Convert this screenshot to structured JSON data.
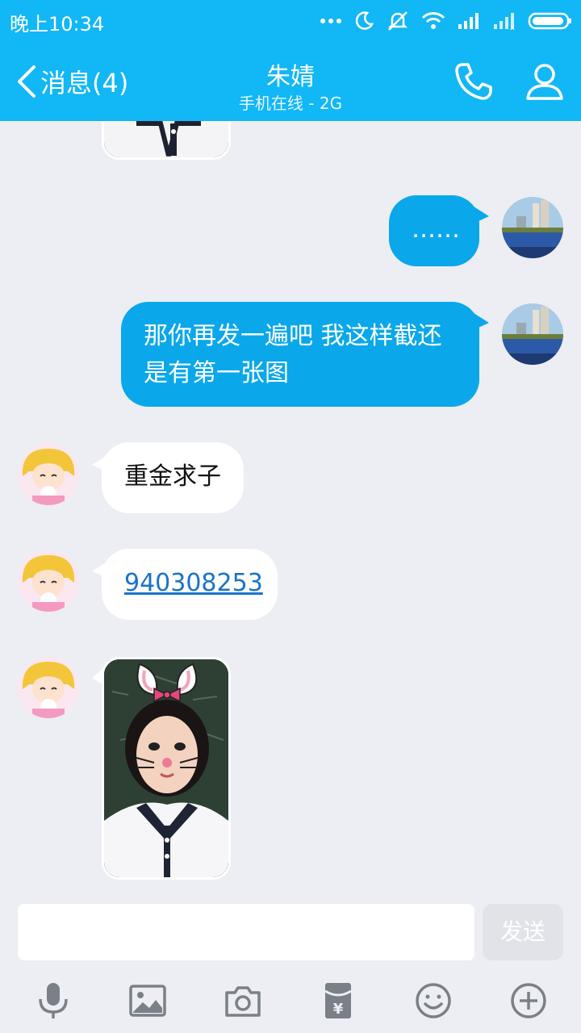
{
  "status_bar": {
    "time": "晚上10:34"
  },
  "header": {
    "back_label": "消息(4)",
    "contact_name": "朱婧",
    "contact_status": "手机在线 - 2G"
  },
  "messages": [
    {
      "from": "me",
      "text": "……"
    },
    {
      "from": "me",
      "text": "那你再发一遍吧 我这样截还是有第一张图"
    },
    {
      "from": "other",
      "text": "重金求子"
    },
    {
      "from": "other",
      "text": "940308253"
    },
    {
      "from": "other",
      "type": "image"
    }
  ],
  "input": {
    "placeholder": "",
    "send_label": "发送"
  },
  "toolbar": {
    "icons": [
      "microphone-icon",
      "image-icon",
      "camera-icon",
      "red-packet-icon",
      "emoji-icon",
      "plus-icon"
    ]
  },
  "colors": {
    "brand": "#12b7f5",
    "my_bubble": "#0aa8ea",
    "other_bubble": "#ffffff",
    "background": "#eceef3",
    "link": "#1a73c9"
  }
}
